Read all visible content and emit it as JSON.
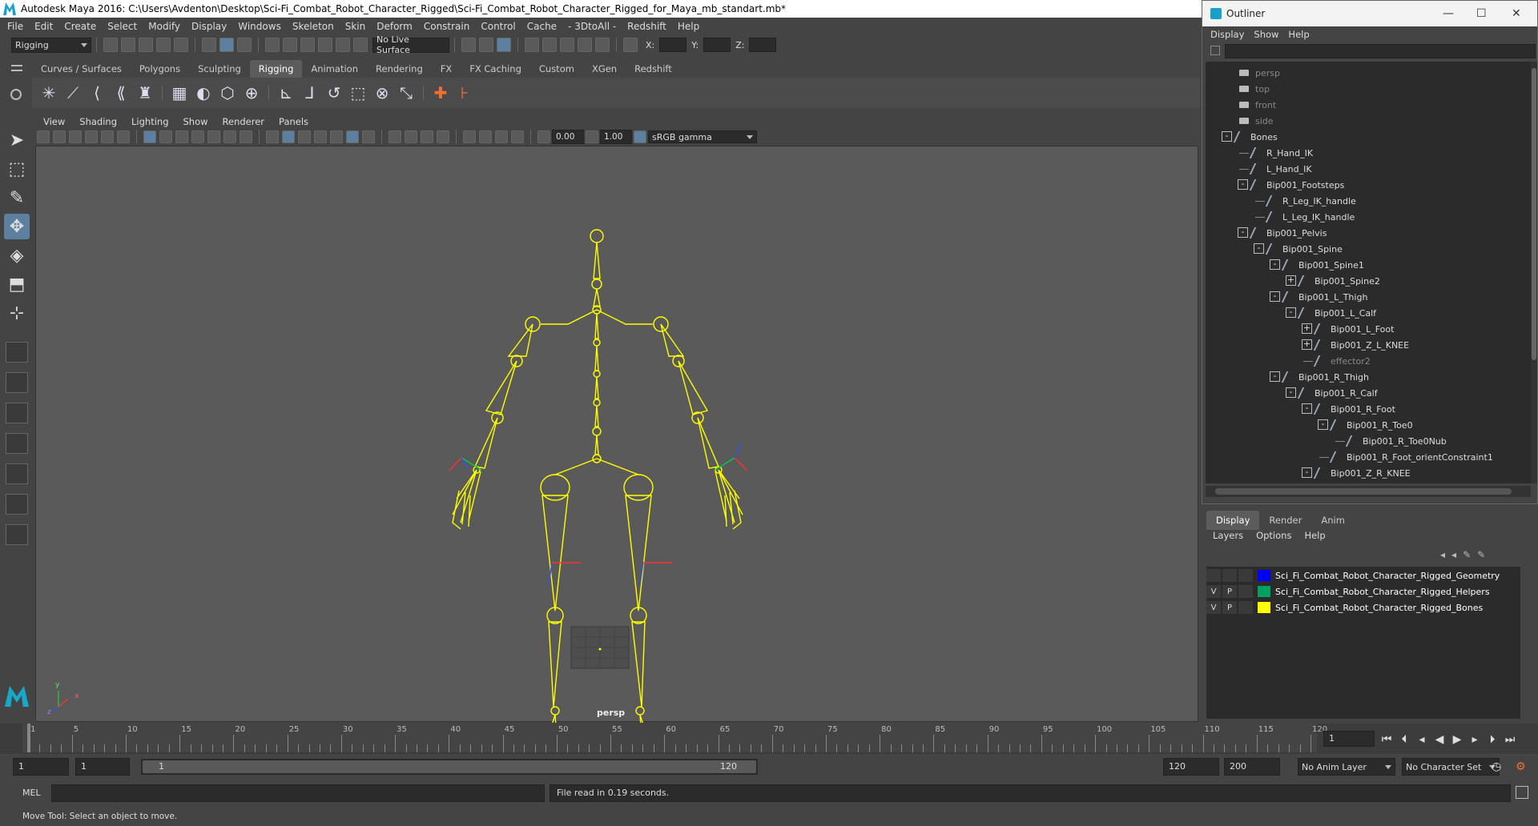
{
  "title_bar": {
    "text": "Autodesk Maya 2016: C:\\Users\\Avdenton\\Desktop\\Sci-Fi_Combat_Robot_Character_Rigged\\Sci-Fi_Combat_Robot_Character_Rigged_for_Maya_mb_standart.mb*"
  },
  "menu": [
    "File",
    "Edit",
    "Create",
    "Select",
    "Modify",
    "Display",
    "Windows",
    "Skeleton",
    "Skin",
    "Deform",
    "Constrain",
    "Control",
    "Cache",
    "- 3DtoAll -",
    "Redshift",
    "Help"
  ],
  "status_line": {
    "menu_set": "Rigging",
    "live_surface": "No Live Surface",
    "x_label": "X:",
    "y_label": "Y:",
    "z_label": "Z:"
  },
  "shelf_tabs": [
    "Curves / Surfaces",
    "Polygons",
    "Sculpting",
    "Rigging",
    "Animation",
    "Rendering",
    "FX",
    "FX Caching",
    "Custom",
    "XGen",
    "Redshift"
  ],
  "shelf_active": "Rigging",
  "viewport": {
    "menu": [
      "View",
      "Shading",
      "Lighting",
      "Show",
      "Renderer",
      "Panels"
    ],
    "exposure": "0.00",
    "gamma": "1.00",
    "color_space": "sRGB gamma",
    "camera_label": "persp",
    "axis_x": "x",
    "axis_y": "y",
    "axis_z": "z"
  },
  "outliner": {
    "title": "Outliner",
    "menu": [
      "Display",
      "Show",
      "Help"
    ],
    "cameras": [
      "persp",
      "top",
      "front",
      "side"
    ],
    "nodes": [
      {
        "label": "Bones",
        "depth": 0,
        "exp": "-"
      },
      {
        "label": "R_Hand_IK",
        "depth": 1,
        "exp": ""
      },
      {
        "label": "L_Hand_IK",
        "depth": 1,
        "exp": ""
      },
      {
        "label": "Bip001_Footsteps",
        "depth": 1,
        "exp": "-"
      },
      {
        "label": "R_Leg_IK_handle",
        "depth": 2,
        "exp": ""
      },
      {
        "label": "L_Leg_IK_handle",
        "depth": 2,
        "exp": ""
      },
      {
        "label": "Bip001_Pelvis",
        "depth": 1,
        "exp": "-"
      },
      {
        "label": "Bip001_Spine",
        "depth": 2,
        "exp": "-"
      },
      {
        "label": "Bip001_Spine1",
        "depth": 3,
        "exp": "-"
      },
      {
        "label": "Bip001_Spine2",
        "depth": 4,
        "exp": "+"
      },
      {
        "label": "Bip001_L_Thigh",
        "depth": 3,
        "exp": "-"
      },
      {
        "label": "Bip001_L_Calf",
        "depth": 4,
        "exp": "-"
      },
      {
        "label": "Bip001_L_Foot",
        "depth": 5,
        "exp": "+"
      },
      {
        "label": "Bip001_Z_L_KNEE",
        "depth": 5,
        "exp": "+"
      },
      {
        "label": "effector2",
        "depth": 5,
        "exp": "",
        "dim": true
      },
      {
        "label": "Bip001_R_Thigh",
        "depth": 3,
        "exp": "-"
      },
      {
        "label": "Bip001_R_Calf",
        "depth": 4,
        "exp": "-"
      },
      {
        "label": "Bip001_R_Foot",
        "depth": 5,
        "exp": "-"
      },
      {
        "label": "Bip001_R_Toe0",
        "depth": 6,
        "exp": "-"
      },
      {
        "label": "Bip001_R_Toe0Nub",
        "depth": 7,
        "exp": ""
      },
      {
        "label": "Bip001_R_Foot_orientConstraint1",
        "depth": 6,
        "exp": ""
      },
      {
        "label": "Bip001_Z_R_KNEE",
        "depth": 5,
        "exp": "-"
      }
    ]
  },
  "layer_editor": {
    "tabs": [
      "Display",
      "Render",
      "Anim"
    ],
    "active_tab": "Display",
    "menu": [
      "Layers",
      "Options",
      "Help"
    ],
    "layers": [
      {
        "v": "",
        "p": "",
        "color": "#0000ff",
        "name": "Sci_Fi_Combat_Robot_Character_Rigged_Geometry"
      },
      {
        "v": "V",
        "p": "P",
        "color": "#00a060",
        "name": "Sci_Fi_Combat_Robot_Character_Rigged_Helpers"
      },
      {
        "v": "V",
        "p": "P",
        "color": "#ffff00",
        "name": "Sci_Fi_Combat_Robot_Character_Rigged_Bones"
      }
    ]
  },
  "time_slider": {
    "ticks": [
      1,
      5,
      10,
      15,
      20,
      25,
      30,
      35,
      40,
      45,
      50,
      55,
      60,
      65,
      70,
      75,
      80,
      85,
      90,
      95,
      100,
      105,
      110,
      115,
      120
    ],
    "current_frame": "1"
  },
  "range_slider": {
    "start": "1",
    "playback_start": "1",
    "range_start_label": "1",
    "range_end_label": "120",
    "playback_end": "120",
    "end": "200",
    "anim_layer": "No Anim Layer",
    "character_set": "No Character Set"
  },
  "command_line": {
    "label": "MEL",
    "result": "File read in  0.19 seconds."
  },
  "help_line": "Move Tool: Select an object to move.",
  "colors": {
    "bones": "#ffff00",
    "accent": "#5d7fa0"
  }
}
